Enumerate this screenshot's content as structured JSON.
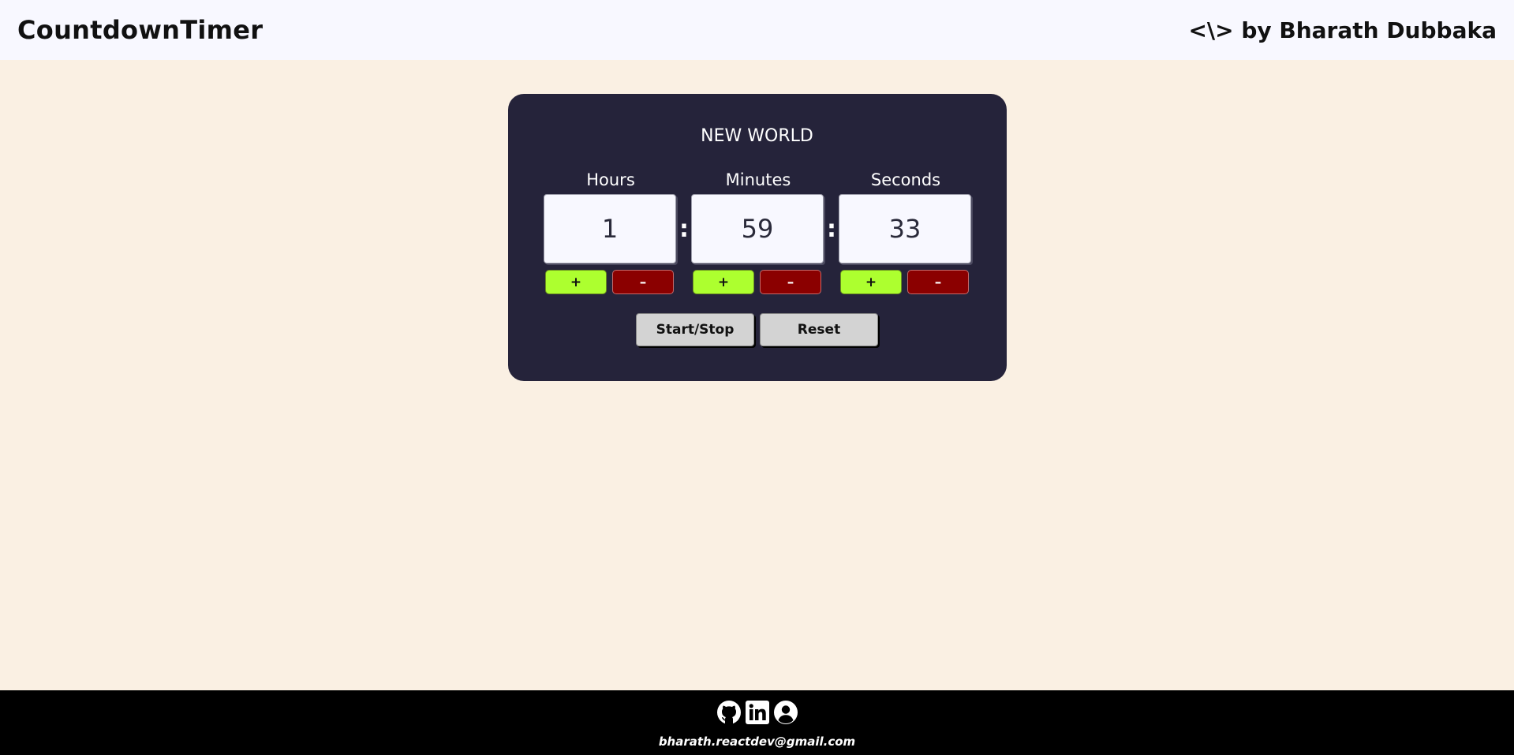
{
  "header": {
    "brand": "CountdownTimer",
    "byline": "<\\> by Bharath Dubbaka"
  },
  "timer": {
    "title": "NEW WORLD",
    "hours": {
      "label": "Hours",
      "value": "1"
    },
    "minutes": {
      "label": "Minutes",
      "value": "59"
    },
    "seconds": {
      "label": "Seconds",
      "value": "33"
    },
    "separator": ":",
    "plus_label": "+",
    "minus_label": "–",
    "start_stop_label": "Start/Stop",
    "reset_label": "Reset"
  },
  "footer": {
    "icons": [
      "github-icon",
      "linkedin-icon",
      "profile-icon"
    ],
    "email": "bharath.reactdev@gmail.com"
  },
  "colors": {
    "page_bg": "#faf0e3",
    "header_bg": "#f8f8ff",
    "card_bg": "#25233a",
    "plus_bg": "#adff2f",
    "minus_bg": "#8b0000",
    "control_bg": "#d3d3d3",
    "footer_bg": "#000000"
  }
}
